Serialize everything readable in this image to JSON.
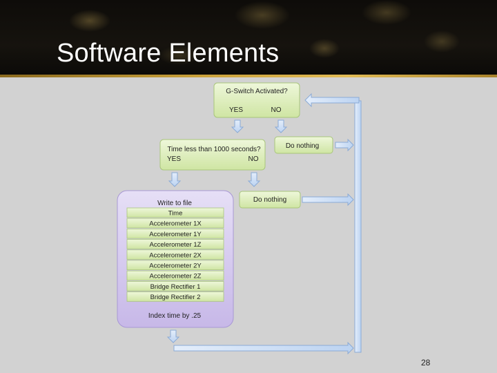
{
  "slide": {
    "title": "Software Elements",
    "page_number": "28"
  },
  "diagram": {
    "gswitch": {
      "question": "G-Switch Activated?",
      "yes": "YES",
      "no": "NO"
    },
    "do_nothing_1": "Do nothing",
    "time_check": {
      "question": "Time less than 1000 seconds?",
      "yes": "YES",
      "no": "NO"
    },
    "do_nothing_2": "Do nothing",
    "write_block": {
      "title": "Write to file",
      "fields": [
        "Time",
        "Accelerometer 1X",
        "Accelerometer 1Y",
        "Accelerometer 1Z",
        "Accelerometer 2X",
        "Accelerometer 2Y",
        "Accelerometer 2Z",
        "Bridge Rectifier 1",
        "Bridge Rectifier 2"
      ],
      "footer": "Index time by .25"
    }
  },
  "colors": {
    "box_fill": "#d9ecb4",
    "box_stroke": "#9fbf6a",
    "write_fill": "#d8cdee",
    "arrow_fill": "#cfe0f6",
    "arrow_stroke": "#7fa3d4"
  }
}
